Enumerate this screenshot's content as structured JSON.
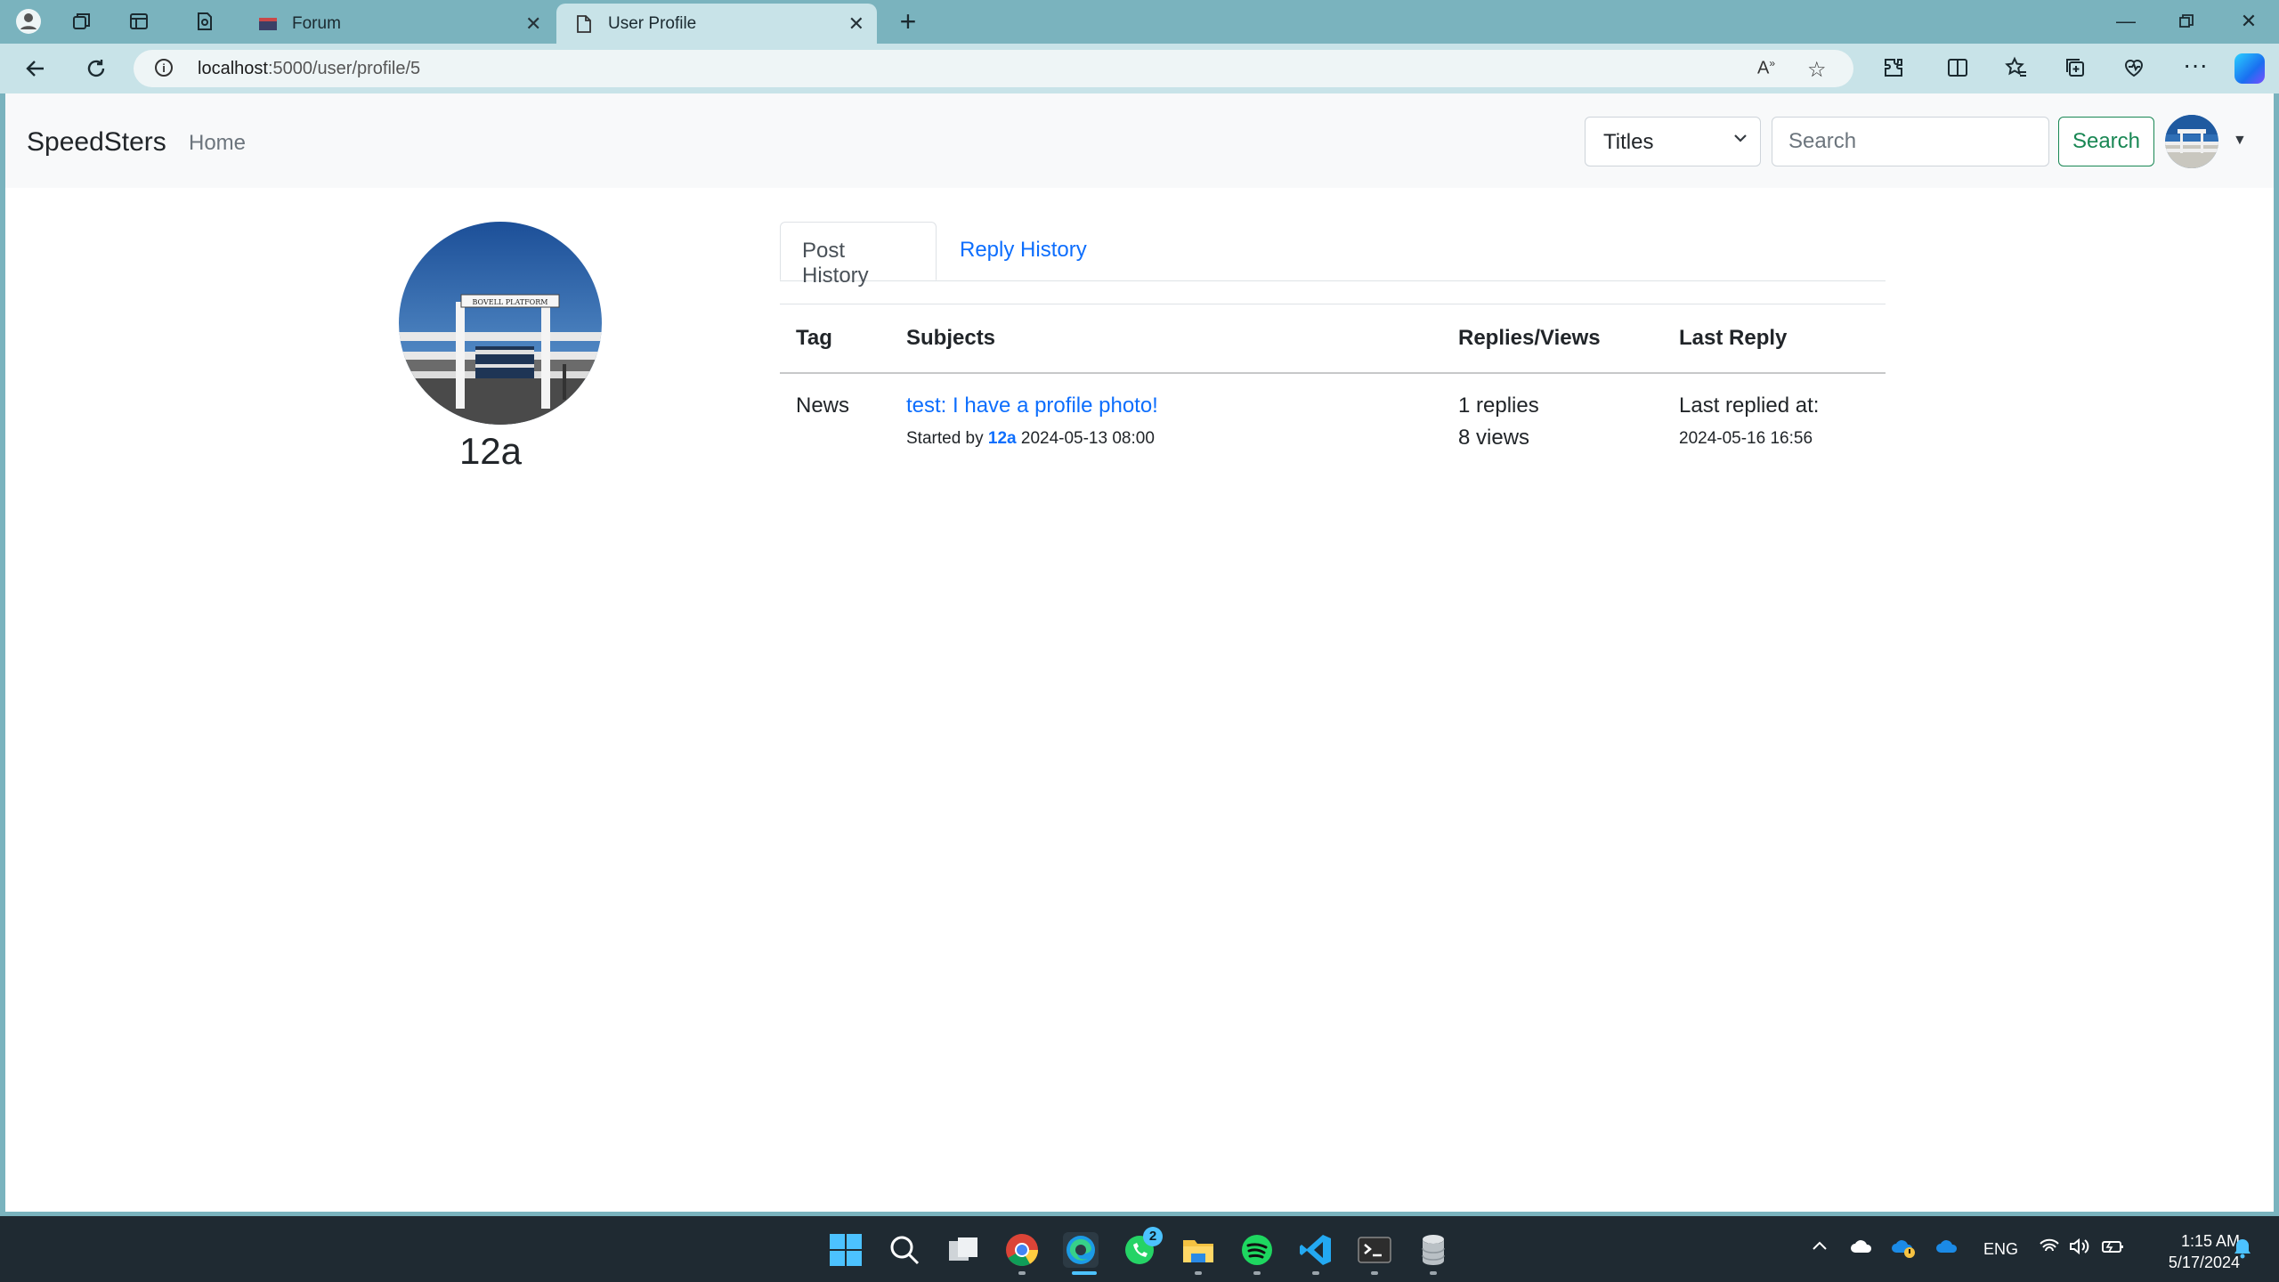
{
  "browser": {
    "tabs": [
      {
        "title": "Forum",
        "active": false
      },
      {
        "title": "User Profile",
        "active": true
      }
    ],
    "url_host": "localhost",
    "url_path": ":5000/user/profile/5"
  },
  "navbar": {
    "brand": "SpeedSters",
    "home": "Home",
    "search_scope": "Titles",
    "search_placeholder": "Search",
    "search_button": "Search"
  },
  "profile": {
    "username": "12a",
    "photo_sign_text": "BOVELL PLATFORM"
  },
  "tabs": {
    "post_history": "Post History",
    "reply_history": "Reply History"
  },
  "table": {
    "headers": [
      "Tag",
      "Subjects",
      "Replies/Views",
      "Last Reply"
    ],
    "rows": [
      {
        "tag": "News",
        "subject": "test: I have a profile photo!",
        "started_by_prefix": "Started by",
        "author": "12a",
        "started_at": "2024-05-13 08:00",
        "replies": "1 replies",
        "views": "8 views",
        "last_reply_label": "Last replied at:",
        "last_reply_at": "2024-05-16 16:56"
      }
    ]
  },
  "taskbar": {
    "whatsapp_badge": "2",
    "language": "ENG",
    "time": "1:15 AM",
    "date": "5/17/2024"
  }
}
